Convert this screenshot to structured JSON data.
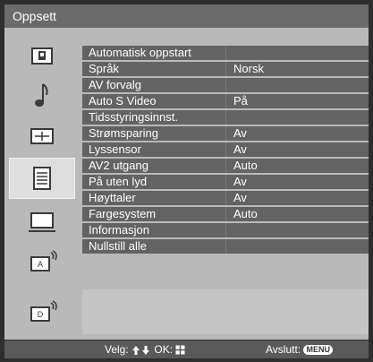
{
  "title": "Oppsett",
  "colors": {
    "frame": "#2e2e2e",
    "title_bar": "#6b6b6b",
    "panel": "#b9b9b9",
    "row": "#636363",
    "selected_icon": "#dedede"
  },
  "sidebar": {
    "icons": [
      {
        "name": "picture-icon"
      },
      {
        "name": "sound-icon"
      },
      {
        "name": "screen-icon"
      },
      {
        "name": "setup-icon",
        "selected": true
      },
      {
        "name": "pc-icon"
      },
      {
        "name": "analog-channel-icon"
      },
      {
        "name": "digital-channel-icon"
      }
    ]
  },
  "menu": {
    "items": [
      {
        "label": "Automatisk oppstart",
        "value": ""
      },
      {
        "label": "Språk",
        "value": "Norsk"
      },
      {
        "label": "AV forvalg",
        "value": ""
      },
      {
        "label": "Auto S Video",
        "value": "På"
      },
      {
        "label": "Tidsstyringsinnst.",
        "value": ""
      },
      {
        "label": "Strømsparing",
        "value": "Av"
      },
      {
        "label": "Lyssensor",
        "value": "Av"
      },
      {
        "label": "AV2 utgang",
        "value": "Auto"
      },
      {
        "label": "På uten lyd",
        "value": "Av"
      },
      {
        "label": "Høyttaler",
        "value": "Av"
      },
      {
        "label": "Fargesystem",
        "value": "Auto"
      },
      {
        "label": "Informasjon",
        "value": ""
      },
      {
        "label": "Nullstill alle",
        "value": ""
      }
    ]
  },
  "footer": {
    "select_label": "Velg:",
    "ok_label": "OK:",
    "exit_label": "Avslutt:",
    "menu_key": "MENU"
  }
}
